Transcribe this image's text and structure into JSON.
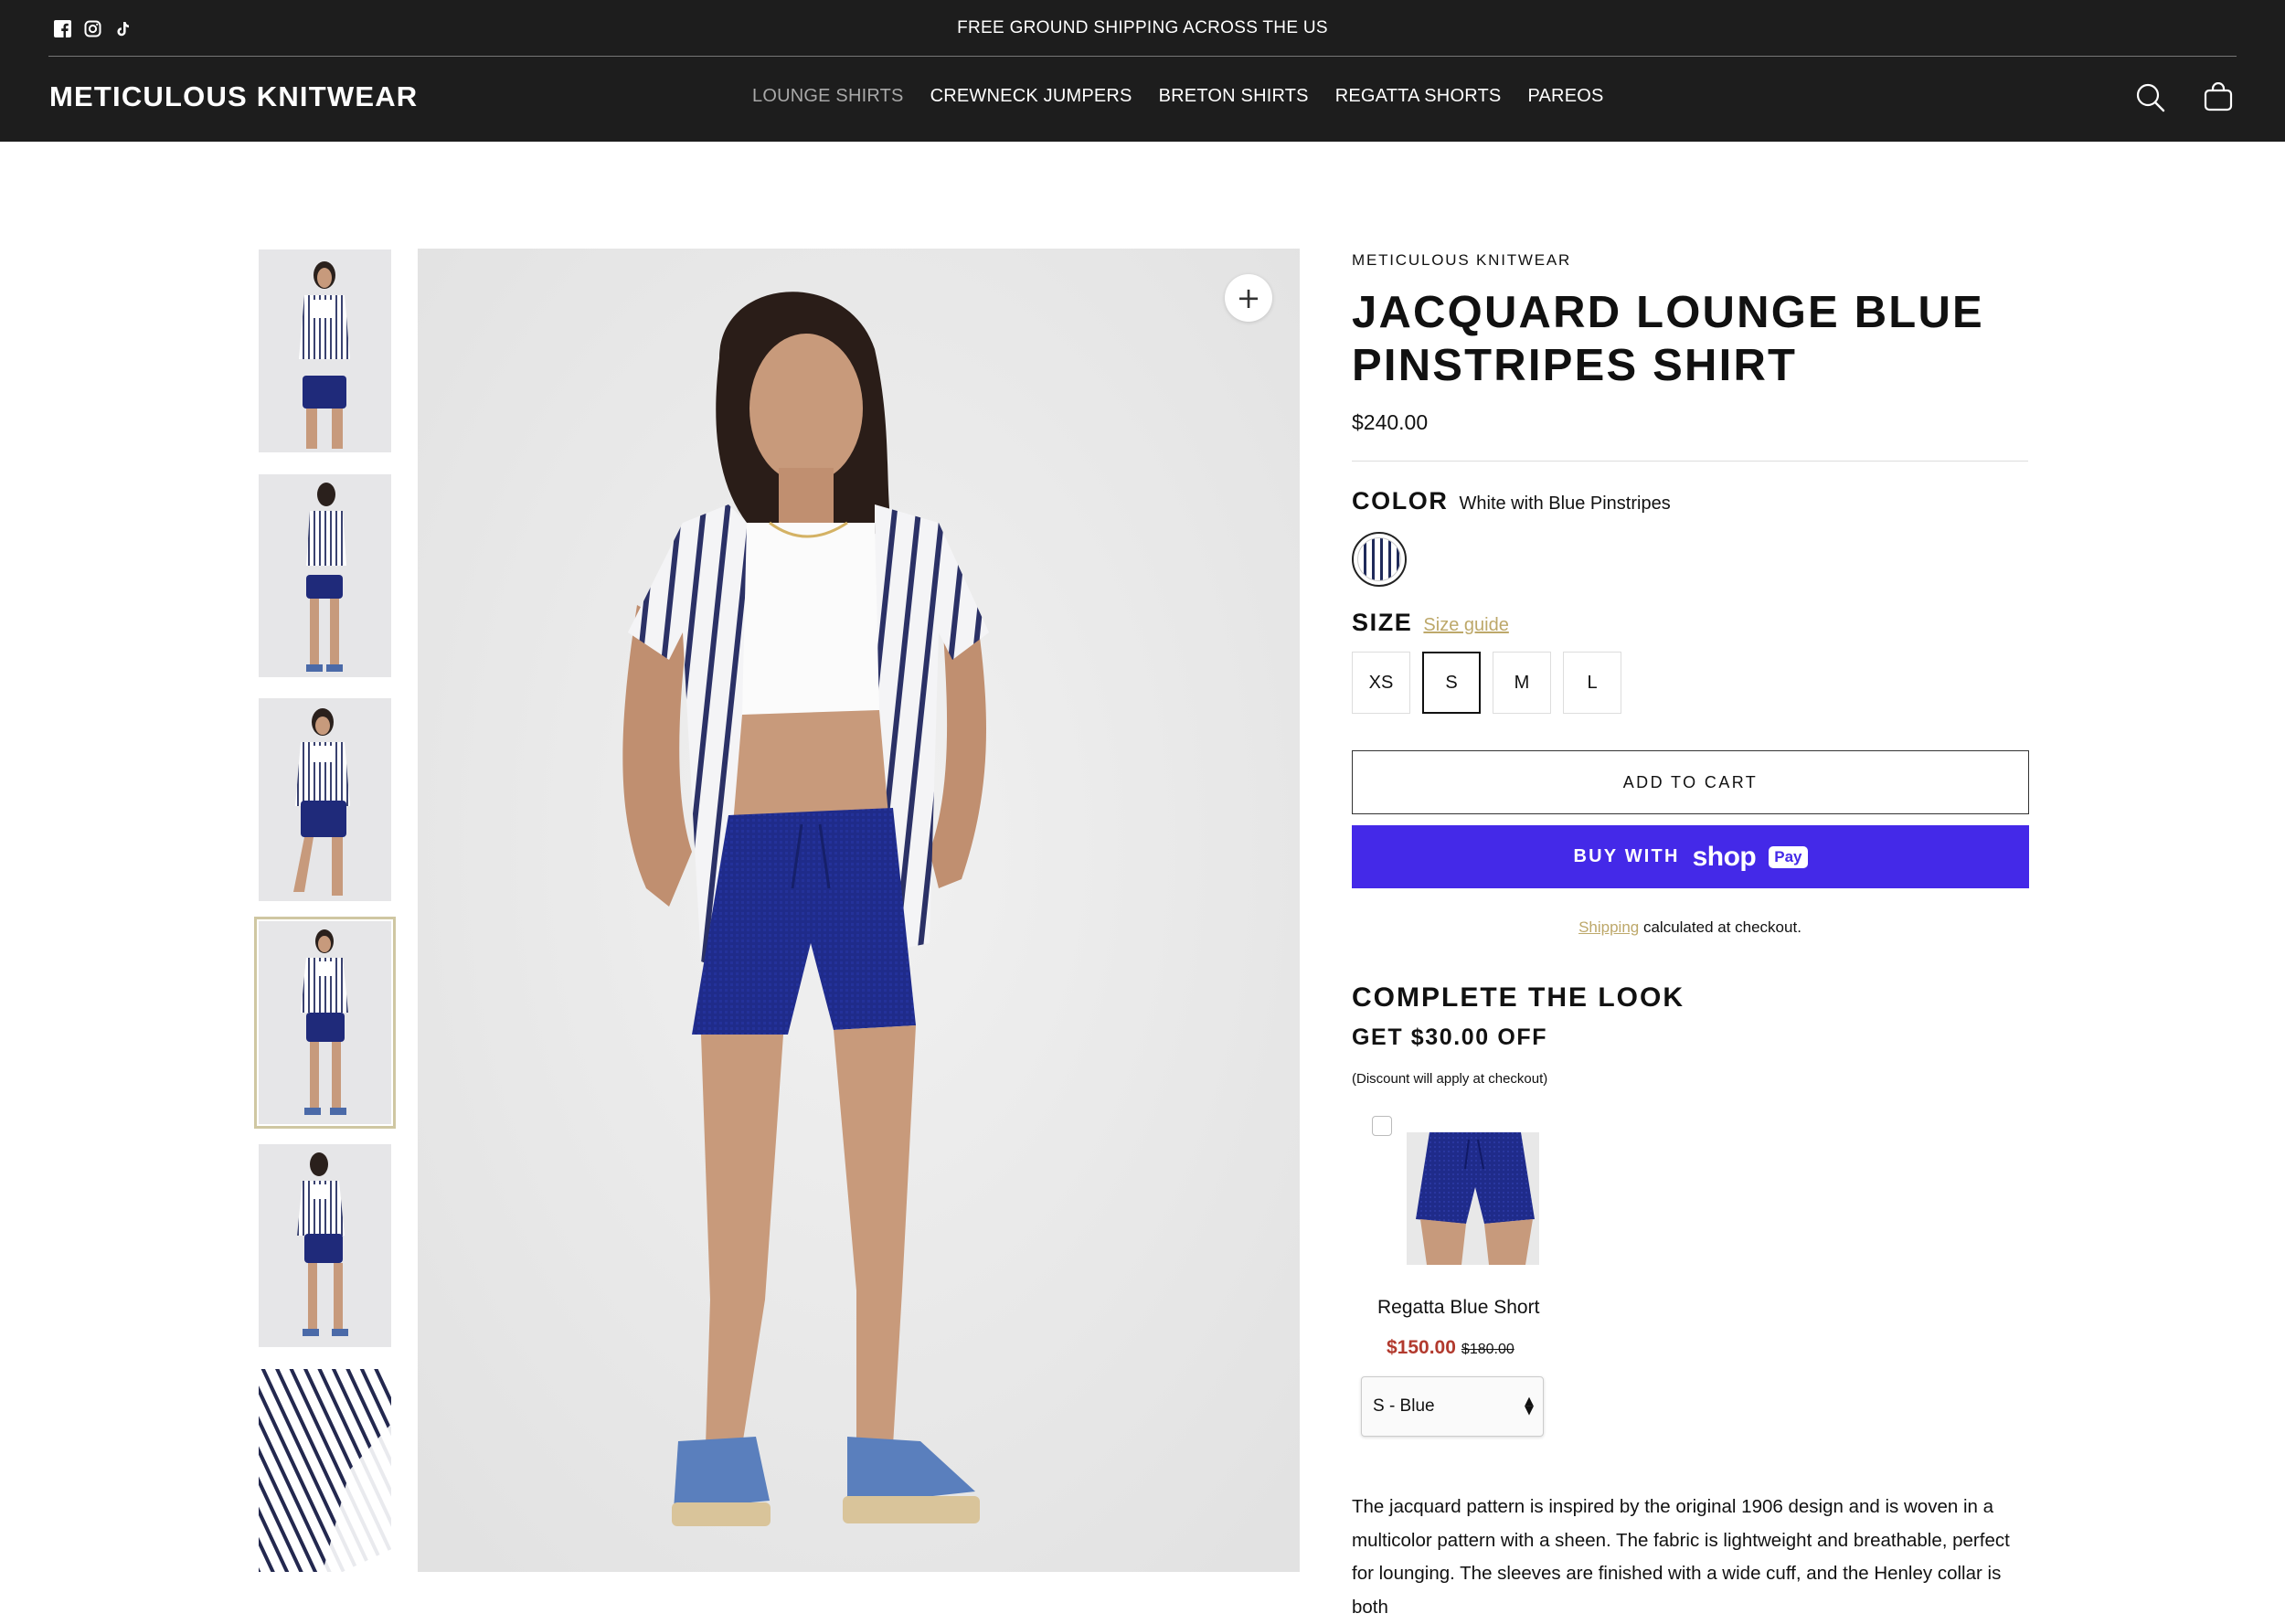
{
  "header": {
    "announcement": "FREE GROUND SHIPPING ACROSS THE US",
    "logo": "METICULOUS KNITWEAR",
    "nav": [
      {
        "label": "LOUNGE SHIRTS",
        "active": true
      },
      {
        "label": "CREWNECK JUMPERS",
        "active": false
      },
      {
        "label": "BRETON SHIRTS",
        "active": false
      },
      {
        "label": "REGATTA SHORTS",
        "active": false
      },
      {
        "label": "PAREOS",
        "active": false
      }
    ],
    "social_icons": [
      "facebook-icon",
      "instagram-icon",
      "tiktok-icon"
    ],
    "right_icons": [
      "search-icon",
      "cart-icon"
    ]
  },
  "gallery": {
    "thumbnail_count": 6,
    "selected_thumbnail": 4,
    "zoom_symbol": "+"
  },
  "product": {
    "vendor": "METICULOUS KNITWEAR",
    "title": "JACQUARD LOUNGE BLUE PINSTRIPES SHIRT",
    "price": "$240.00",
    "color_label": "COLOR",
    "color_value": "White with Blue Pinstripes",
    "size_label": "SIZE",
    "size_guide": "Size guide",
    "sizes": [
      "XS",
      "S",
      "M",
      "L"
    ],
    "selected_size": "S",
    "add_to_cart": "ADD TO CART",
    "buy_with": "BUY WITH",
    "shop_word": "shop",
    "pay_word": "Pay",
    "shipping_link": "Shipping",
    "shipping_rest": " calculated at checkout."
  },
  "complete_the_look": {
    "title": "COMPLETE THE LOOK",
    "subtitle": "GET $30.00 OFF",
    "note": "(Discount will apply at checkout)",
    "item": {
      "name": "Regatta Blue Short",
      "sale_price": "$150.00",
      "original_price": "$180.00",
      "variant": "S - Blue"
    }
  },
  "description": "The jacquard pattern is inspired by the original 1906 design and is woven in a multicolor pattern with a sheen. The fabric is lightweight and breathable, perfect for lounging. The sleeves are finished with a wide cuff, and the Henley collar is both",
  "colors": {
    "header_bg": "#1d1d1d",
    "shop_pay": "#4429e8",
    "sale_red": "#b23a2e",
    "link_gold": "#bda86a",
    "navy": "#1f2a5a"
  }
}
